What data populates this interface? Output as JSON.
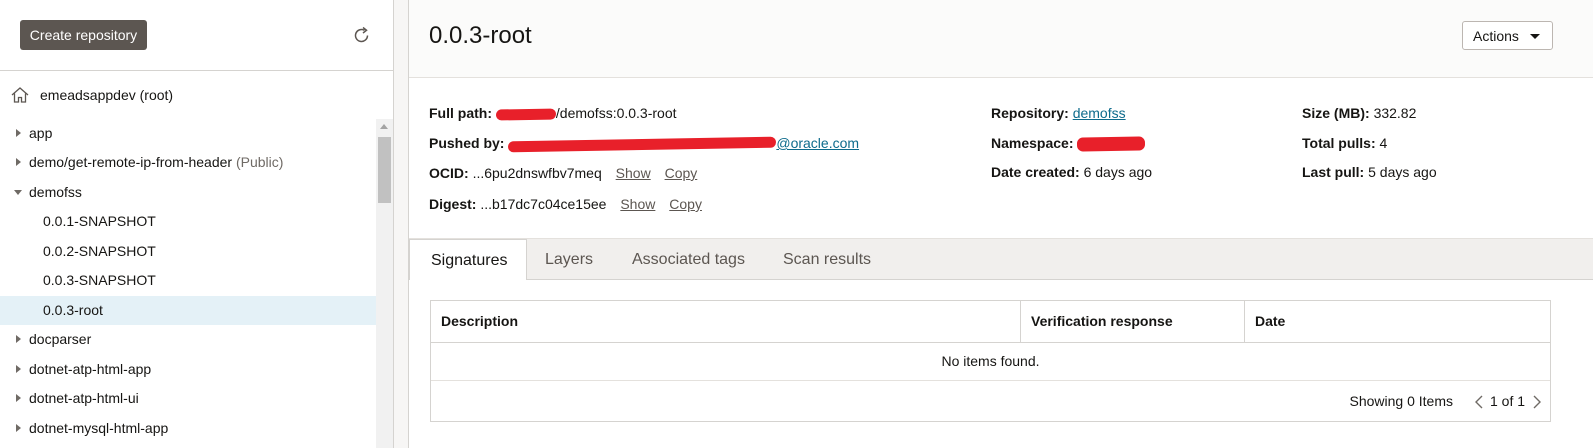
{
  "sidebar": {
    "create_button": "Create repository",
    "root_label": "emeadsappdev (root)",
    "items": [
      {
        "label": "app",
        "public": ""
      },
      {
        "label": "demo/get-remote-ip-from-header",
        "public": "(Public)"
      },
      {
        "label": "demofss",
        "public": ""
      },
      {
        "label": "0.0.1-SNAPSHOT",
        "public": ""
      },
      {
        "label": "0.0.2-SNAPSHOT",
        "public": ""
      },
      {
        "label": "0.0.3-SNAPSHOT",
        "public": ""
      },
      {
        "label": "0.0.3-root",
        "public": ""
      },
      {
        "label": "docparser",
        "public": ""
      },
      {
        "label": "dotnet-atp-html-app",
        "public": ""
      },
      {
        "label": "dotnet-atp-html-ui",
        "public": ""
      },
      {
        "label": "dotnet-mysql-html-app",
        "public": ""
      }
    ]
  },
  "header": {
    "title": "0.0.3-root",
    "actions_label": "Actions"
  },
  "details": {
    "full_path_label": "Full path:",
    "full_path_value": "/demofss:0.0.3-root",
    "pushed_by_label": "Pushed by:",
    "pushed_by_value": "@oracle.com",
    "ocid_label": "OCID:",
    "ocid_value": "...6pu2dnswfbv7meq",
    "digest_label": "Digest:",
    "digest_value": "...b17dc7c04ce15ee",
    "show_label": "Show",
    "copy_label": "Copy",
    "repository_label": "Repository:",
    "repository_value": "demofss",
    "namespace_label": "Namespace:",
    "date_created_label": "Date created:",
    "date_created_value": "6 days ago",
    "size_label": "Size (MB):",
    "size_value": "332.82",
    "total_pulls_label": "Total pulls:",
    "total_pulls_value": "4",
    "last_pull_label": "Last pull:",
    "last_pull_value": "5 days ago"
  },
  "tabs": [
    "Signatures",
    "Layers",
    "Associated tags",
    "Scan results"
  ],
  "table": {
    "columns": [
      "Description",
      "Verification response",
      "Date"
    ],
    "empty_message": "No items found.",
    "showing": "Showing 0 Items",
    "page_info": "1 of 1"
  },
  "colors": {
    "primary_button": "#5c5651",
    "link": "#0d6b8c",
    "selected_row": "#e4f1f7",
    "redaction": "#e8202a"
  }
}
